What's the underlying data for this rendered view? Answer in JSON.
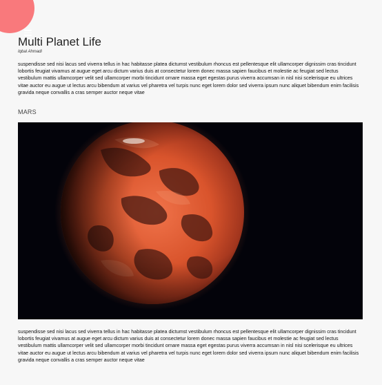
{
  "menu": {
    "icon": "hamburger-menu-icon",
    "color": "#f9797c"
  },
  "article": {
    "title": "Multi Planet Life",
    "author": "Iqbal Ahmadi",
    "paragraph_1": "suspendisse sed nisi lacus sed viverra tellus in hac habitasse platea dictumst vestibulum rhoncus est pellentesque elit ullamcorper dignissim cras tincidunt lobortis feugiat vivamus at augue eget arcu dictum varius duis at consectetur lorem donec massa sapien faucibus et molestie ac feugiat sed lectus vestibulum mattis ullamcorper velit sed ullamcorper morbi tincidunt ornare massa eget egestas purus viverra accumsan in nisl nisi scelerisque eu ultrices vitae auctor eu augue ut lectus arcu bibendum at varius vel pharetra vel turpis nunc eget lorem dolor sed viverra ipsum nunc aliquet bibendum enim facilisis gravida neque convallis a cras semper auctor neque vitae",
    "section_label": "MARS",
    "image": "mars-planet-image",
    "paragraph_2": "suspendisse sed nisi lacus sed viverra tellus in hac habitasse platea dictumst vestibulum rhoncus est pellentesque elit ullamcorper dignissim cras tincidunt lobortis feugiat vivamus at augue eget arcu dictum varius duis at consectetur lorem donec massa sapien faucibus et molestie ac feugiat sed lectus vestibulum mattis ullamcorper velit sed ullamcorper morbi tincidunt ornare massa eget egestas purus viverra accumsan in nisl nisi scelerisque eu ultrices vitae auctor eu augue ut lectus arcu bibendum at varius vel pharetra vel turpis nunc eget lorem dolor sed viverra ipsum nunc aliquet bibendum enim facilisis gravida neque convallis a cras semper auctor neque vitae"
  }
}
